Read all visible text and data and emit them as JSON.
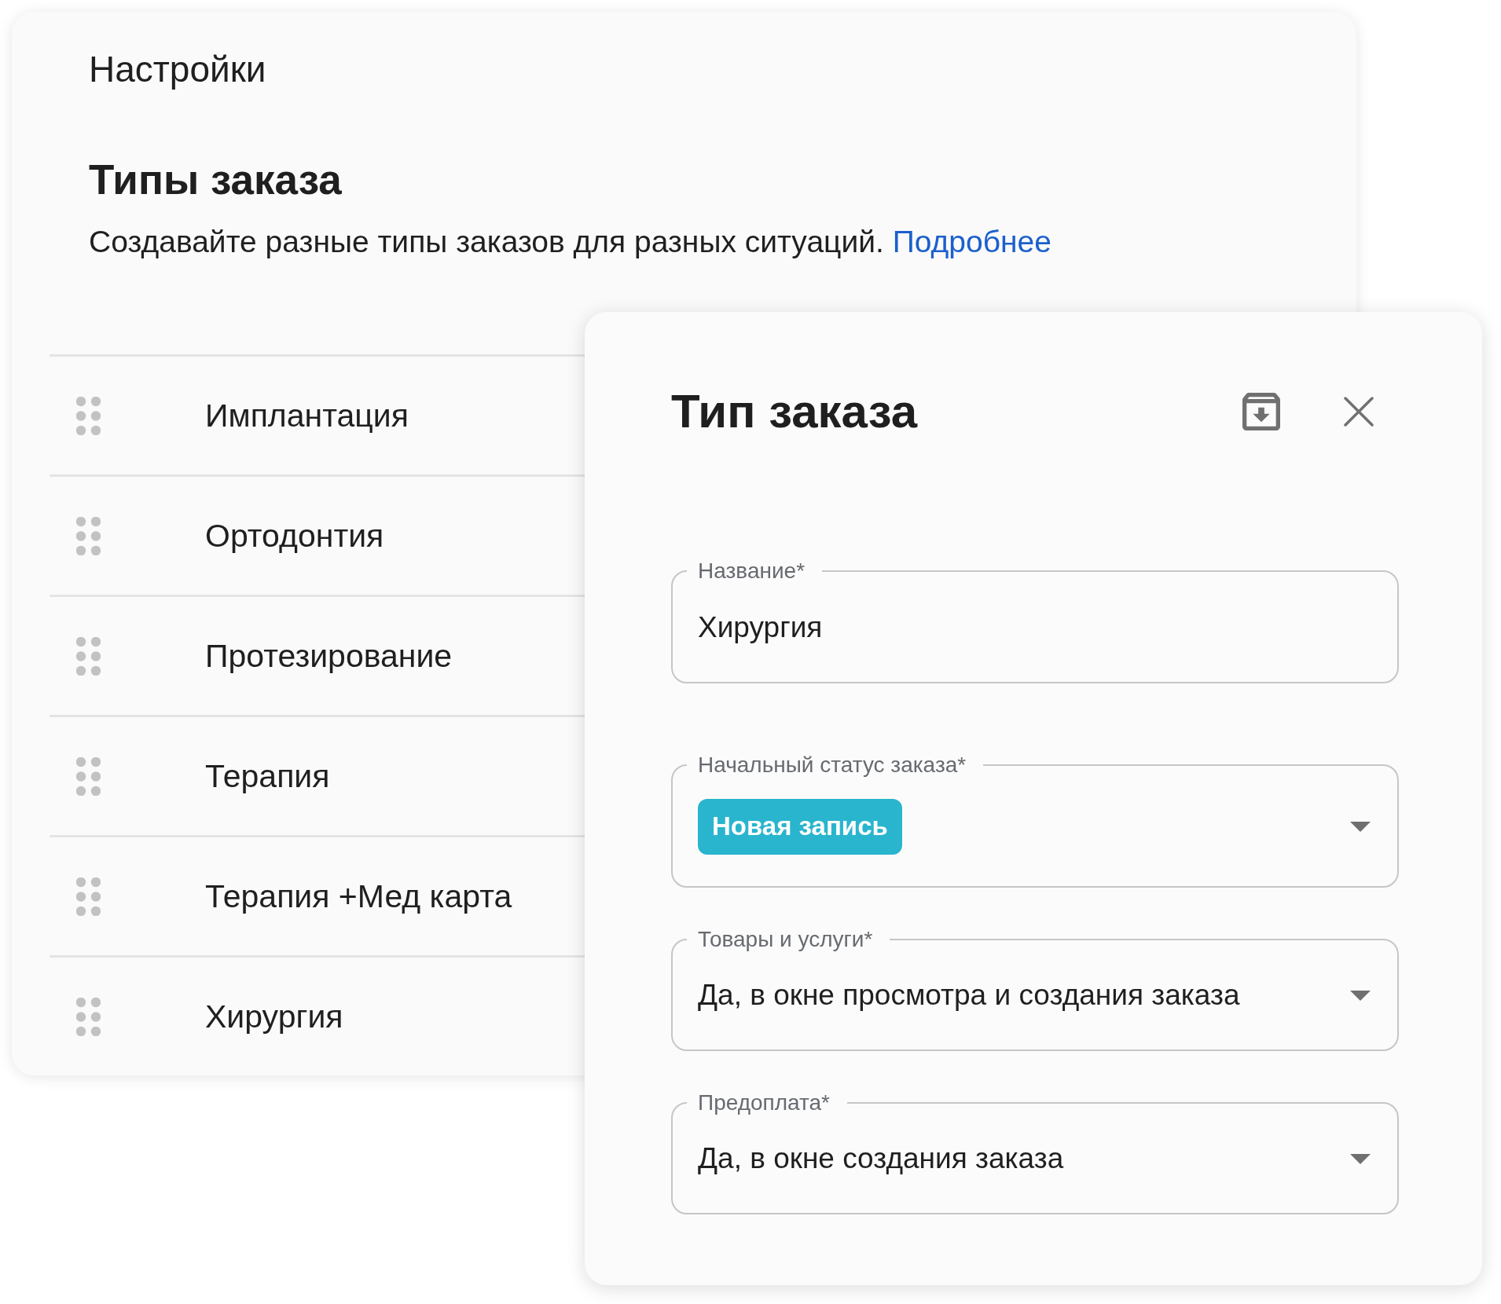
{
  "settings": {
    "title": "Настройки",
    "heading": "Типы заказа",
    "description": "Создавайте разные типы заказов для разных ситуаций.",
    "link": "Подробнее"
  },
  "order_types": [
    "Имплантация",
    "Ортодонтия",
    "Протезирование",
    "Терапия",
    "Терапия +Мед карта",
    "Хирургия"
  ],
  "dialog": {
    "title": "Тип заказа",
    "fields": [
      {
        "kind": "text",
        "label": "Название*",
        "value": "Хирургия"
      },
      {
        "kind": "status",
        "label": "Начальный статус заказа*",
        "value": "Новая запись",
        "color": "#29b5ce"
      },
      {
        "kind": "select",
        "label": "Товары и услуги*",
        "value": "Да, в окне просмотра и создания заказа"
      },
      {
        "kind": "select",
        "label": "Предоплата*",
        "value": "Да, в окне создания заказа"
      }
    ]
  }
}
